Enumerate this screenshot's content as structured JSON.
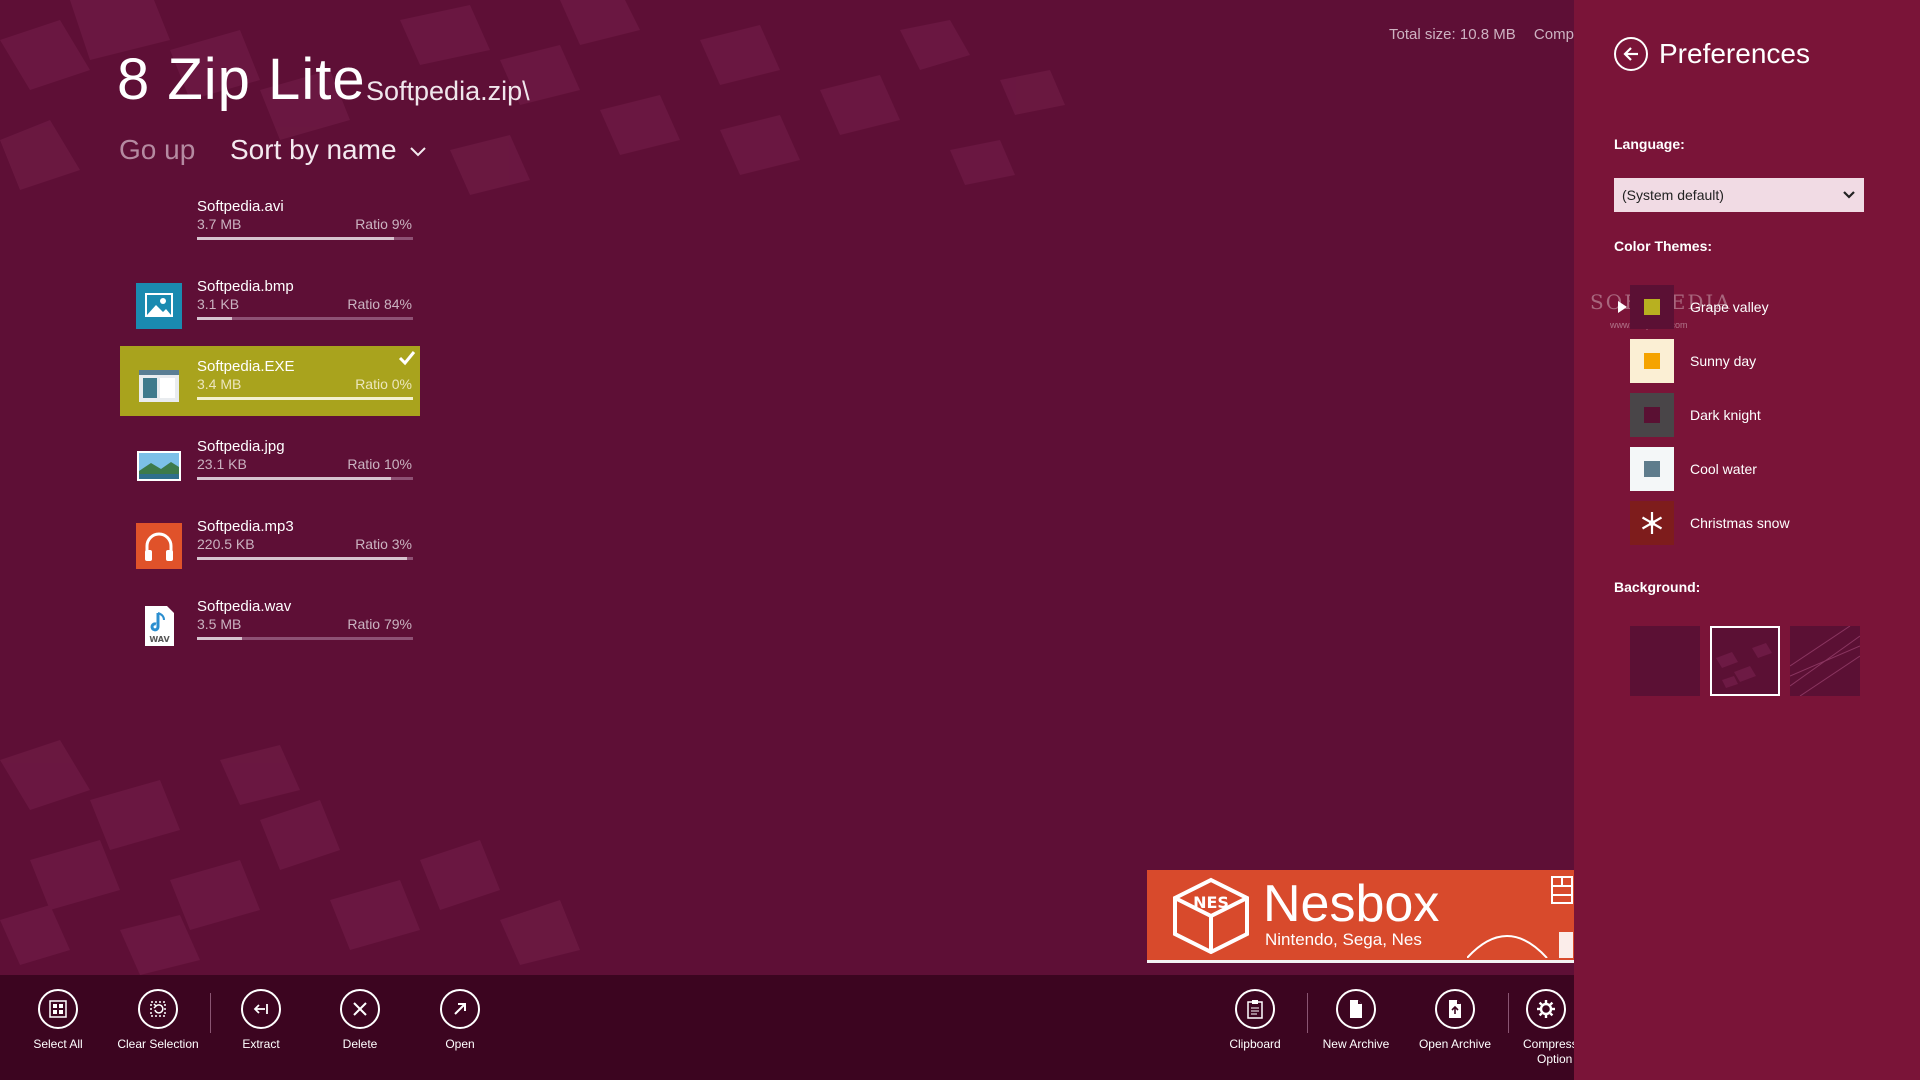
{
  "app": {
    "title": "8 Zip Lite",
    "path": "Softpedia.zip\\"
  },
  "nav": {
    "go_up": "Go up",
    "sort": "Sort by name"
  },
  "stats": {
    "total_size": "Total size: 10.8 MB",
    "compressed": "Compre"
  },
  "files": [
    {
      "name": "Softpedia.avi",
      "size": "3.7 MB",
      "ratio": "Ratio 9%",
      "ratio_value": 0.91,
      "icon": "none",
      "selected": false
    },
    {
      "name": "Softpedia.bmp",
      "size": "3.1 KB",
      "ratio": "Ratio 84%",
      "ratio_value": 0.16,
      "icon": "image-icon",
      "selected": false
    },
    {
      "name": "Softpedia.EXE",
      "size": "3.4 MB",
      "ratio": "Ratio 0%",
      "ratio_value": 1.0,
      "icon": "app-window-icon",
      "selected": true
    },
    {
      "name": "Softpedia.jpg",
      "size": "23.1 KB",
      "ratio": "Ratio 10%",
      "ratio_value": 0.9,
      "icon": "landscape-photo-icon",
      "selected": false
    },
    {
      "name": "Softpedia.mp3",
      "size": "220.5 KB",
      "ratio": "Ratio 3%",
      "ratio_value": 0.97,
      "icon": "headphones-icon",
      "selected": false
    },
    {
      "name": "Softpedia.wav",
      "size": "3.5 MB",
      "ratio": "Ratio 79%",
      "ratio_value": 0.21,
      "icon": "wav-file-icon",
      "selected": false
    }
  ],
  "ad": {
    "title": "Nesbox",
    "subtitle": "Nintendo, Sega, Nes",
    "logo_text": "NES"
  },
  "appbar": {
    "left": [
      "Select All",
      "Clear Selection",
      "Extract",
      "Delete",
      "Open"
    ],
    "right": [
      "Clipboard",
      "New Archive",
      "Open Archive",
      "Compress",
      "Option"
    ]
  },
  "preferences": {
    "title": "Preferences",
    "language_label": "Language:",
    "language_value": "(System default)",
    "themes_label": "Color Themes:",
    "themes": [
      {
        "name": "Grape valley",
        "box": "#5b1034",
        "inner": "#b8b020",
        "active": true
      },
      {
        "name": "Sunny day",
        "box": "#fbefd4",
        "inner": "#f5a300",
        "active": false
      },
      {
        "name": "Dark knight",
        "box": "#494548",
        "inner": "#5a1033",
        "active": false
      },
      {
        "name": "Cool water",
        "box": "#f4f7f8",
        "inner": "#5e7c8c",
        "active": false
      },
      {
        "name": "Christmas snow",
        "box": "#7e1c1c",
        "inner": "snowflake",
        "active": false
      }
    ],
    "background_label": "Background:",
    "watermark": "SOFTPEDIA",
    "watermark_url": "www.softpedia.com"
  },
  "colors": {
    "accent": "#a9a31d",
    "background": "#5e0f36",
    "pane": "#7a1438",
    "appbar": "#3c0520",
    "ad": "#d84a2c"
  }
}
